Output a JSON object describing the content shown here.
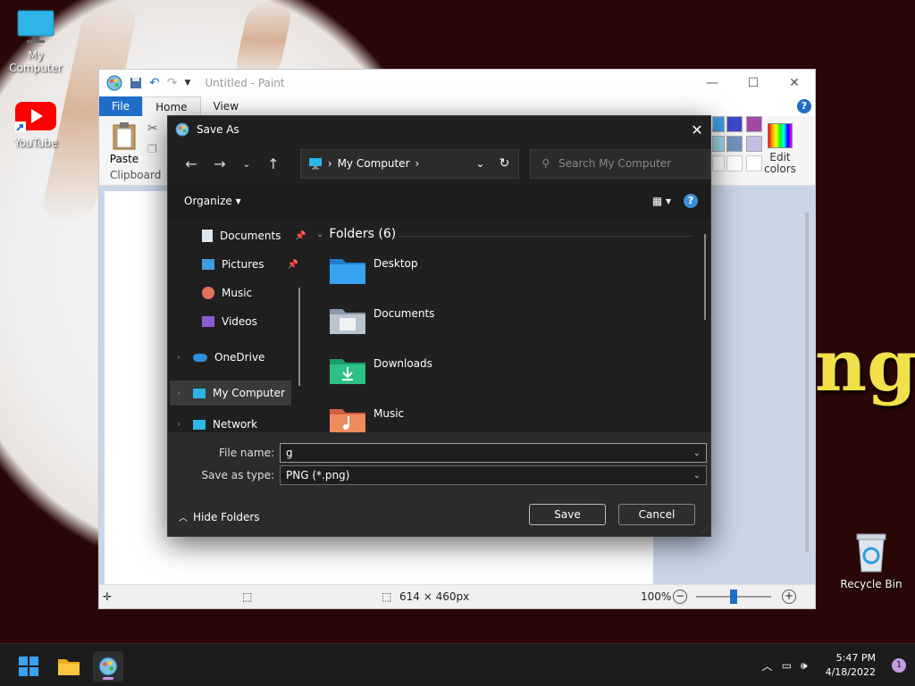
{
  "desktop": {
    "icons": [
      {
        "label": "My Computer"
      },
      {
        "label": "YouTube"
      },
      {
        "label": "Recycle Bin"
      }
    ],
    "background_text": "ng"
  },
  "paint": {
    "title": "Untitled - Paint",
    "tabs": [
      "File",
      "Home",
      "View"
    ],
    "ribbon": {
      "paste": "Paste",
      "clipboard": "Clipboard",
      "edit_colors_1": "Edit",
      "edit_colors_2": "colors"
    },
    "status": {
      "dimensions": "614 × 460px",
      "zoom": "100%"
    }
  },
  "dialog": {
    "title": "Save As",
    "address": {
      "location": "My Computer"
    },
    "search_placeholder": "Search My Computer",
    "organize": "Organize",
    "sidebar": [
      {
        "label": "Documents"
      },
      {
        "label": "Pictures"
      },
      {
        "label": "Music"
      },
      {
        "label": "Videos"
      },
      {
        "label": "OneDrive"
      },
      {
        "label": "My Computer"
      },
      {
        "label": "Network"
      }
    ],
    "folders_header": "Folders (6)",
    "folders": [
      {
        "name": "Desktop"
      },
      {
        "name": "Documents"
      },
      {
        "name": "Downloads"
      },
      {
        "name": "Music"
      }
    ],
    "file_name_label": "File name:",
    "file_name_value": "g",
    "save_type_label": "Save as type:",
    "save_type_value": "PNG (*.png)",
    "hide_folders": "Hide Folders",
    "save_button": "Save",
    "cancel_button": "Cancel"
  },
  "taskbar": {
    "time": "5:47 PM",
    "date": "4/18/2022",
    "notification_count": "1"
  },
  "colors": {
    "accent": "#1e6ec8",
    "dialog_bg": "#202020",
    "taskbar_bg": "#1c1c1c"
  }
}
